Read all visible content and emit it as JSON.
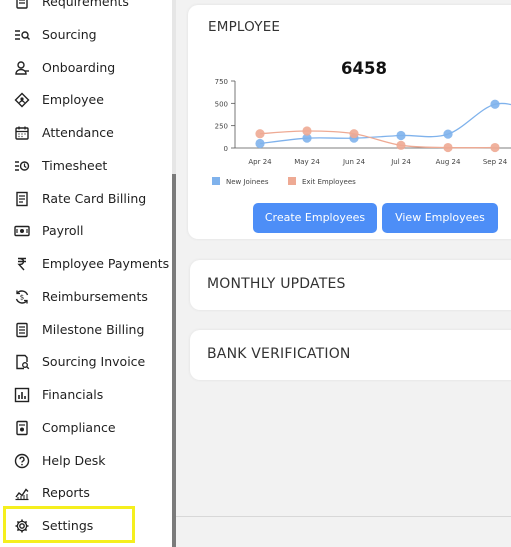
{
  "sidebar": {
    "items": [
      {
        "label": "Requirements",
        "icon": "requirements-icon"
      },
      {
        "label": "Sourcing",
        "icon": "sourcing-icon"
      },
      {
        "label": "Onboarding",
        "icon": "onboarding-icon"
      },
      {
        "label": "Employee",
        "icon": "employee-icon"
      },
      {
        "label": "Attendance",
        "icon": "calendar-icon"
      },
      {
        "label": "Timesheet",
        "icon": "timesheet-icon"
      },
      {
        "label": "Rate Card Billing",
        "icon": "billing-icon"
      },
      {
        "label": "Payroll",
        "icon": "payroll-icon"
      },
      {
        "label": "Employee Payments",
        "icon": "rupee-icon"
      },
      {
        "label": "Reimbursements",
        "icon": "reimbursement-icon"
      },
      {
        "label": "Milestone Billing",
        "icon": "document-icon"
      },
      {
        "label": "Sourcing Invoice",
        "icon": "invoice-search-icon"
      },
      {
        "label": "Financials",
        "icon": "financials-icon"
      },
      {
        "label": "Compliance",
        "icon": "compliance-icon"
      },
      {
        "label": "Help Desk",
        "icon": "help-icon"
      },
      {
        "label": "Reports",
        "icon": "reports-icon"
      },
      {
        "label": "Settings",
        "icon": "gear-icon"
      }
    ],
    "highlighted": "Settings",
    "highlight_color": "#f5ef1e"
  },
  "employee_card": {
    "title": "EMPLOYEE",
    "total": "6458",
    "create_button": "Create Employees",
    "view_button": "View Employees",
    "button_color": "#4d8ef7"
  },
  "monthly_updates": {
    "title": "MONTHLY UPDATES"
  },
  "bank_verification": {
    "title": "BANK VERIFICATION"
  },
  "chart_data": {
    "type": "line",
    "categories": [
      "Apr 24",
      "May 24",
      "Jun 24",
      "Jul 24",
      "Aug 24",
      "Sep 24"
    ],
    "series": [
      {
        "name": "New Joinees",
        "values": [
          50,
          110,
          110,
          140,
          155,
          490
        ],
        "color": "#7fb2ec"
      },
      {
        "name": "Exit Employees",
        "values": [
          160,
          190,
          160,
          30,
          5,
          5
        ],
        "color": "#eeaa94"
      }
    ],
    "yticks": [
      0,
      250,
      500,
      750
    ],
    "ylim": [
      0,
      750
    ],
    "legend": "bottom-left",
    "grid": false
  }
}
